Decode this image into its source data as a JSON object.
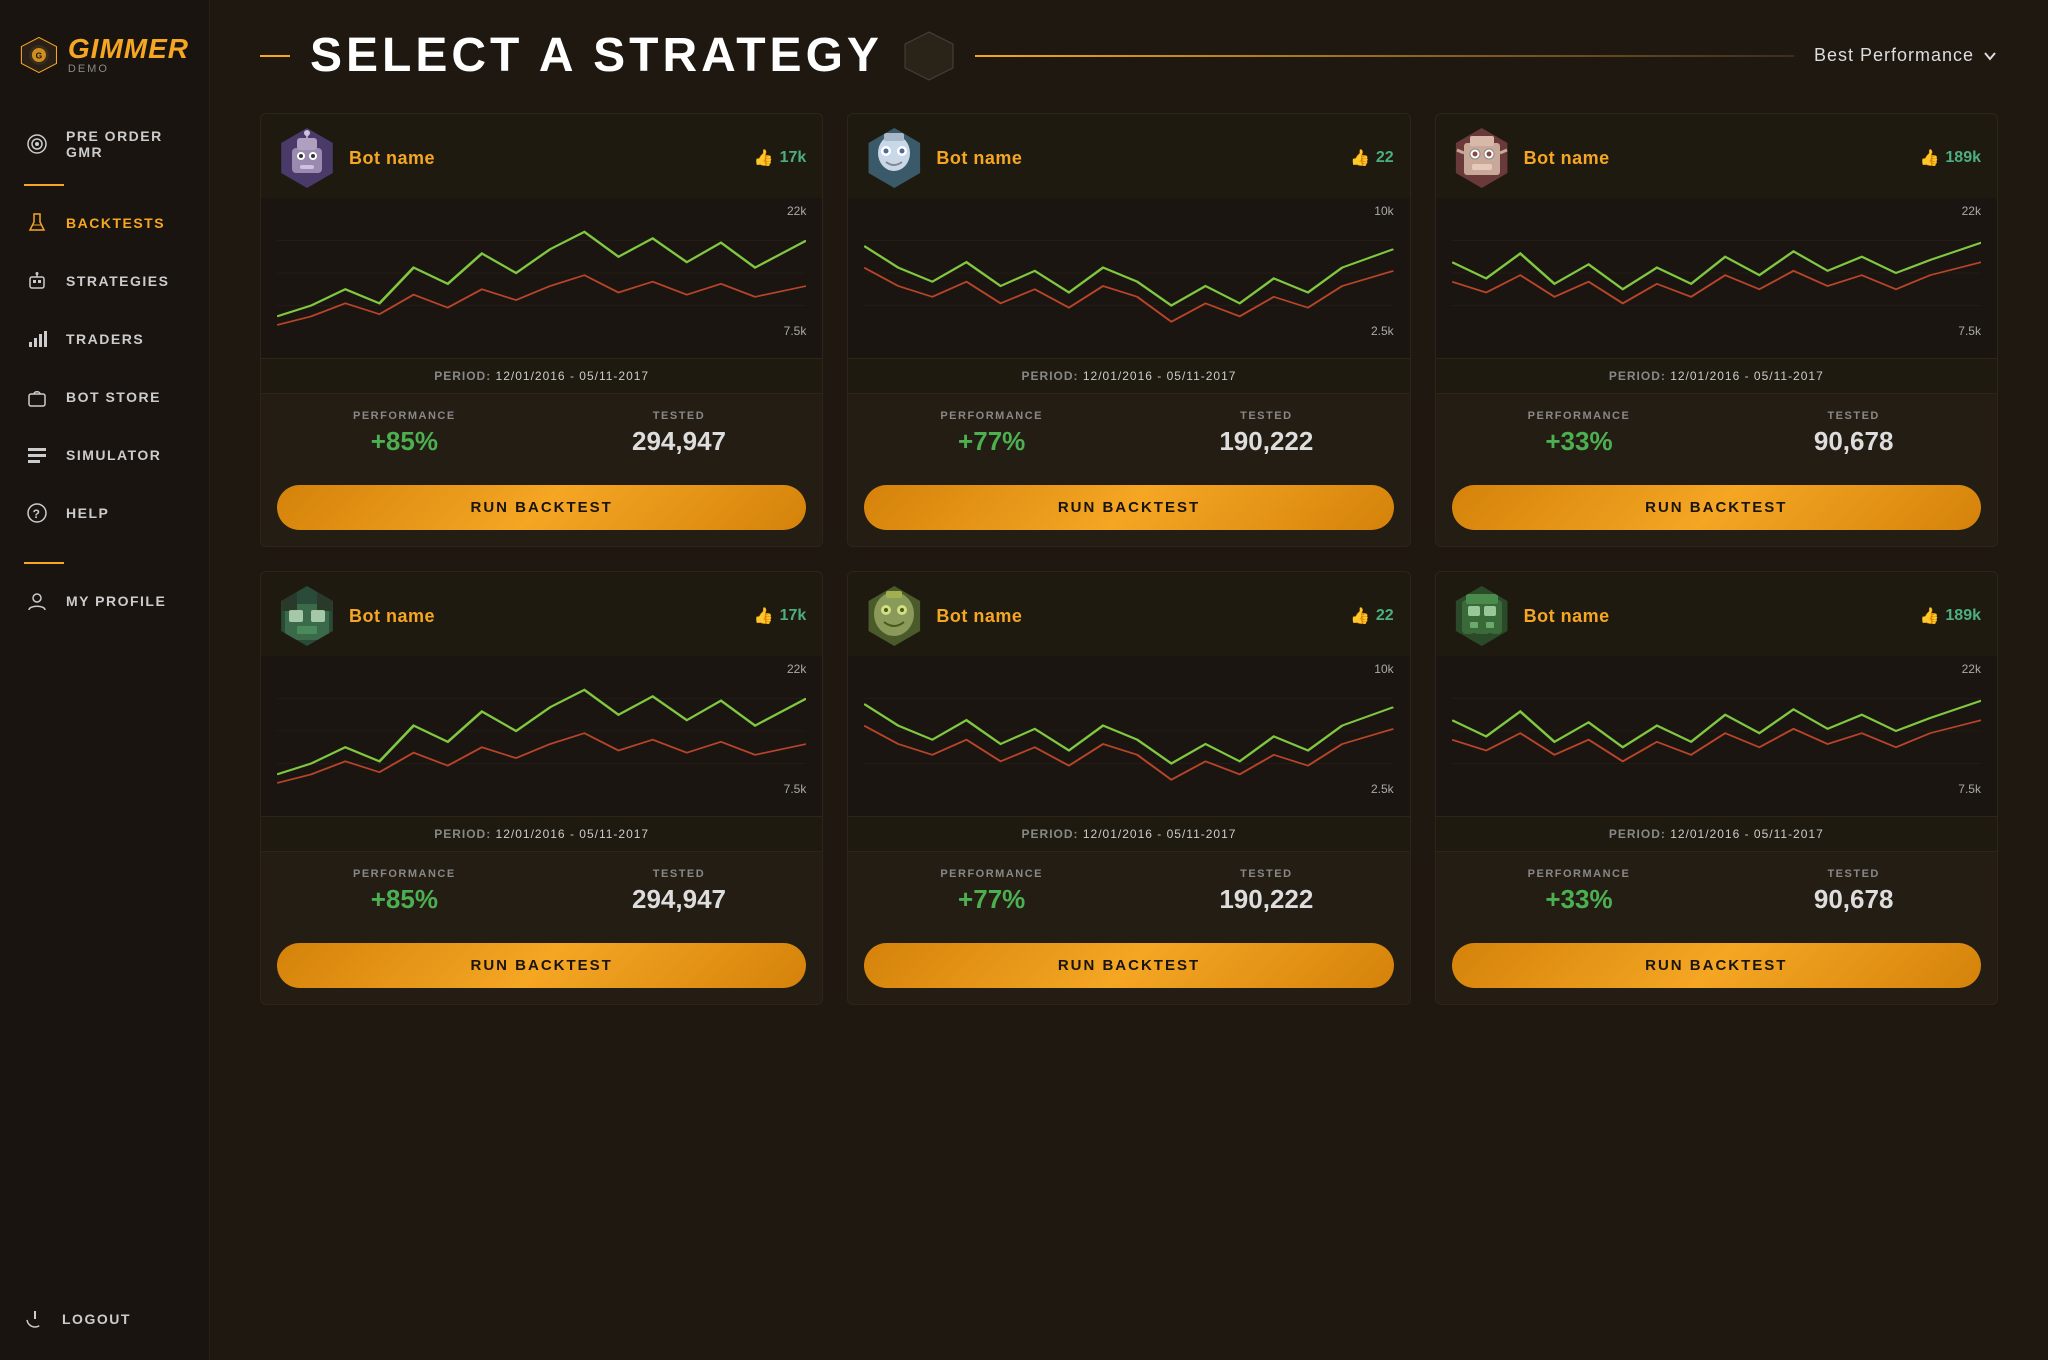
{
  "sidebar": {
    "logo": {
      "text": "GIMMER",
      "sub": "DEMO"
    },
    "nav": [
      {
        "id": "pre-order",
        "label": "PRE ORDER GMR",
        "icon": "target"
      },
      {
        "id": "backtests",
        "label": "BACKTESTS",
        "icon": "flask",
        "active": true
      },
      {
        "id": "strategies",
        "label": "STRATEGIES",
        "icon": "robot"
      },
      {
        "id": "traders",
        "label": "TRADERS",
        "icon": "chart"
      },
      {
        "id": "bot-store",
        "label": "BOT STORE",
        "icon": "bag"
      },
      {
        "id": "simulator",
        "label": "SIMULATOR",
        "icon": "bars"
      },
      {
        "id": "help",
        "label": "HELP",
        "icon": "circle"
      }
    ],
    "profile": "MY PROFILE",
    "logout": "LOGOUT"
  },
  "header": {
    "title": "SELECT A STRATEGY",
    "filter": "Best Performance"
  },
  "cards": [
    {
      "id": "card-1",
      "bot_name": "Bot name",
      "likes": "17k",
      "period": "12/01/2016 - 05/11-2017",
      "chart_max": "22k",
      "chart_min": "7.5k",
      "performance_label": "PERFORMANCE",
      "performance_value": "+85%",
      "tested_label": "TESTED",
      "tested_value": "294,947",
      "btn_label": "RUN BACKTEST",
      "avatar_color": "#6a4a8a",
      "avatar_emoji": "🤖"
    },
    {
      "id": "card-2",
      "bot_name": "Bot name",
      "likes": "22",
      "period": "12/01/2016 - 05/11-2017",
      "chart_max": "10k",
      "chart_min": "2.5k",
      "performance_label": "PERFORMANCE",
      "performance_value": "+77%",
      "tested_label": "TESTED",
      "tested_value": "190,222",
      "btn_label": "RUN BACKTEST",
      "avatar_color": "#4a6a8a",
      "avatar_emoji": "🦾"
    },
    {
      "id": "card-3",
      "bot_name": "Bot name",
      "likes": "189k",
      "period": "12/01/2016 - 05/11-2017",
      "chart_max": "22k",
      "chart_min": "7.5k",
      "performance_label": "PERFORMANCE",
      "performance_value": "+33%",
      "tested_label": "TESTED",
      "tested_value": "90,678",
      "btn_label": "RUN BACKTEST",
      "avatar_color": "#7a3030",
      "avatar_emoji": "👾"
    },
    {
      "id": "card-4",
      "bot_name": "Bot name",
      "likes": "17k",
      "period": "12/01/2016 - 05/11-2017",
      "chart_max": "22k",
      "chart_min": "7.5k",
      "performance_label": "PERFORMANCE",
      "performance_value": "+85%",
      "tested_label": "TESTED",
      "tested_value": "294,947",
      "btn_label": "RUN BACKTEST",
      "avatar_color": "#2a5a3a",
      "avatar_emoji": "🌆"
    },
    {
      "id": "card-5",
      "bot_name": "Bot name",
      "likes": "22",
      "period": "12/01/2016 - 05/11-2017",
      "chart_max": "10k",
      "chart_min": "2.5k",
      "performance_label": "PERFORMANCE",
      "performance_value": "+77%",
      "tested_label": "TESTED",
      "tested_value": "190,222",
      "btn_label": "RUN BACKTEST",
      "avatar_color": "#5a6a2a",
      "avatar_emoji": "🤖"
    },
    {
      "id": "card-6",
      "bot_name": "Bot name",
      "likes": "189k",
      "period": "12/01/2016 - 05/11-2017",
      "chart_max": "22k",
      "chart_min": "7.5k",
      "performance_label": "PERFORMANCE",
      "performance_value": "+33%",
      "tested_label": "TESTED",
      "tested_value": "90,678",
      "btn_label": "RUN BACKTEST",
      "avatar_color": "#3a5a2a",
      "avatar_emoji": "🎮"
    }
  ],
  "chart_paths": [
    "M0,90 L30,80 L50,60 L70,75 L90,40 L110,55 L130,30 L150,50 L170,35 L190,20 L210,40 L230,25 L250,45 L270,30 L290,50 L310,35",
    "M0,30 L30,50 L50,70 L70,55 L90,75 L110,60 L130,80 L150,50 L170,65 L190,110 L210,80 L230,100 L250,70 L270,90 L290,60 L310,40",
    "M0,40 L30,55 L50,35 L70,60 L90,45 L110,70 L130,50 L150,65 L170,40 L190,55 L210,35 L230,50 L250,40 L270,55 L290,45 L310,30",
    "M0,90 L30,80 L50,60 L70,75 L90,40 L110,55 L130,30 L150,50 L170,35 L190,20 L210,40 L230,25 L250,45 L270,30 L290,50 L310,35",
    "M0,30 L30,50 L50,70 L70,55 L90,75 L110,60 L130,80 L150,50 L170,65 L190,110 L210,80 L230,100 L250,70 L270,90 L290,60 L310,40",
    "M0,40 L30,55 L50,35 L70,60 L90,45 L110,70 L130,50 L150,65 L170,40 L190,55 L210,35 L230,50 L250,40 L270,55 L290,45 L310,30"
  ],
  "chart_paths2": [
    "M0,100 L30,95 L50,80 L70,90 L90,70 L110,85 L130,65 L150,80 L170,70 L190,60 L210,75 L230,65 L250,80 L270,70 L290,85 L310,75",
    "M0,60 L30,70 L50,80 L70,65 L90,85 L110,75 L130,90 L150,70 L170,80 L190,100 L210,85 L230,95 L250,80 L270,90 L290,75 L310,60",
    "M0,60 L30,70 L50,55 L70,75 L90,60 L110,80 L130,65 L150,75 L170,58 L190,68 L210,52 L230,65 L250,55 L270,68 L290,60 L310,45"
  ]
}
